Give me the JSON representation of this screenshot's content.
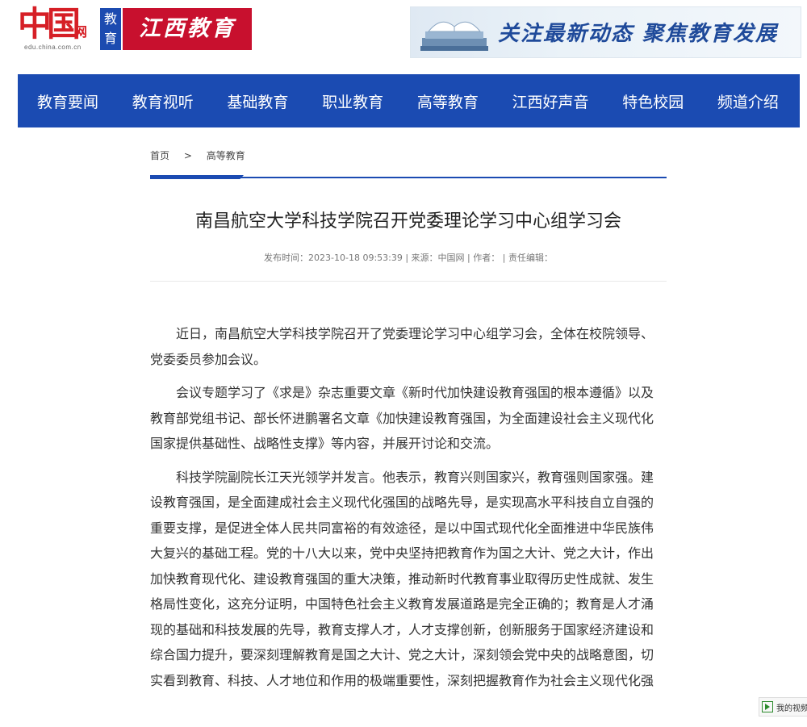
{
  "header": {
    "logo_chars": "中国",
    "logo_wang": "网",
    "logo_domain": "edu.china.com.cn",
    "edu_badge": [
      "教",
      "育"
    ],
    "jx_badge": "江西教育",
    "banner_text": "关注最新动态 聚焦教育发展"
  },
  "nav": {
    "items": [
      "教育要闻",
      "教育视听",
      "基础教育",
      "职业教育",
      "高等教育",
      "江西好声音",
      "特色校园",
      "频道介绍"
    ]
  },
  "breadcrumb": {
    "home": "首页",
    "sep": ">",
    "current": "高等教育"
  },
  "article": {
    "title": "南昌航空大学科技学院召开党委理论学习中心组学习会",
    "meta": "发布时间：2023-10-18 09:53:39 | 来源：中国网 | 作者： | 责任编辑：",
    "paragraphs": [
      "近日，南昌航空大学科技学院召开了党委理论学习中心组学习会，全体在校院领导、党委委员参加会议。",
      "会议专题学习了《求是》杂志重要文章《新时代加快建设教育强国的根本遵循》以及教育部党组书记、部长怀进鹏署名文章《加快建设教育强国，为全面建设社会主义现代化国家提供基础性、战略性支撑》等内容，并展开讨论和交流。",
      "科技学院副院长江天光领学并发言。他表示，教育兴则国家兴，教育强则国家强。建设教育强国，是全面建成社会主义现代化强国的战略先导，是实现高水平科技自立自强的重要支撑，是促进全体人民共同富裕的有效途径，是以中国式现代化全面推进中华民族伟大复兴的基础工程。党的十八大以来，党中央坚持把教育作为国之大计、党之大计，作出加快教育现代化、建设教育强国的重大决策，推动新时代教育事业取得历史性成就、发生格局性变化，这充分证明，中国特色社会主义教育发展道路是完全正确的；教育是人才涌现的基础和科技发展的先导，教育支撑人才，人才支撑创新，创新服务于国家经济建设和综合国力提升，要深刻理解教育是国之大计、党之大计，深刻领会党中央的战略意图，切实看到教育、科技、人才地位和作用的极端重要性，深刻把握教育作为社会主义现代化强国重要支撑和基础工"
    ]
  },
  "float_bar": {
    "label": "我的视频"
  }
}
